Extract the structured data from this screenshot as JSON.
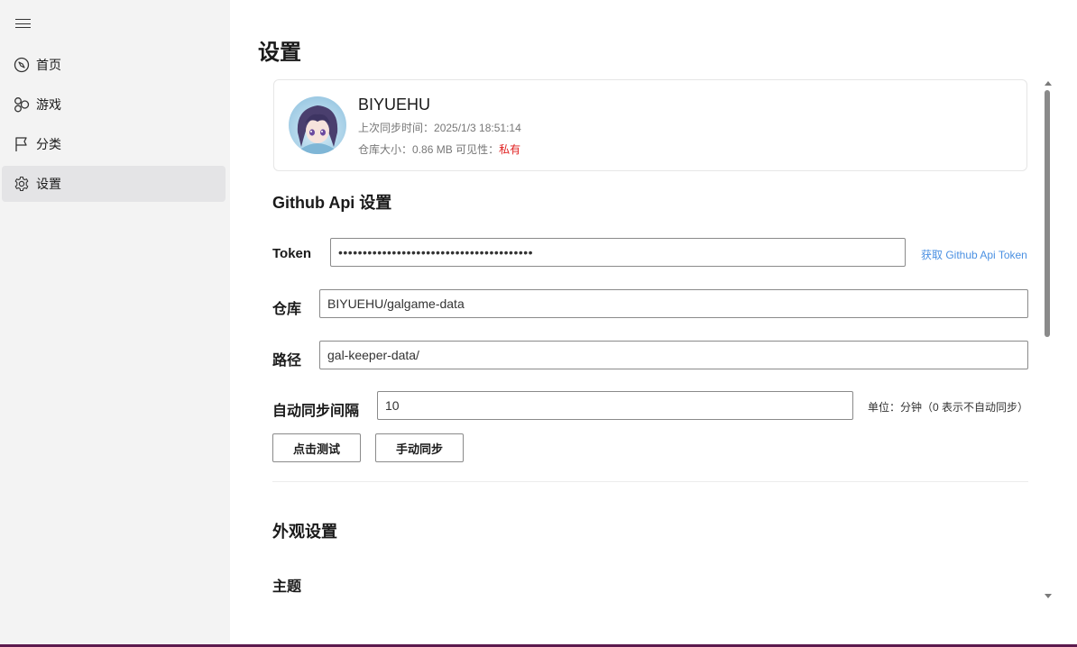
{
  "sidebar": {
    "menu_icon": "hamburger-menu-icon",
    "items": [
      {
        "label": "首页",
        "icon": "compass-icon",
        "active": false
      },
      {
        "label": "游戏",
        "icon": "shapes-icon",
        "active": false
      },
      {
        "label": "分类",
        "icon": "flag-icon",
        "active": false
      },
      {
        "label": "设置",
        "icon": "gear-icon",
        "active": true
      }
    ]
  },
  "page": {
    "title": "设置"
  },
  "profile": {
    "name": "BIYUEHU",
    "sync_label": "上次同步时间：",
    "sync_time": "2025/1/3 18:51:14",
    "size_label": "仓库大小：",
    "size_value": "0.86 MB",
    "visibility_label": "可见性：",
    "visibility_value": "私有"
  },
  "github": {
    "section_title": "Github Api 设置",
    "token_label": "Token",
    "token_value": "••••••••••••••••••••••••••••••••••••••••",
    "token_link": "获取 Github Api Token",
    "repo_label": "仓库",
    "repo_value": "BIYUEHU/galgame-data",
    "path_label": "路径",
    "path_value": "gal-keeper-data/",
    "interval_label": "自动同步间隔",
    "interval_value": "10",
    "interval_hint": "单位：分钟（0 表示不自动同步）",
    "test_button": "点击测试",
    "sync_button": "手动同步"
  },
  "appearance": {
    "section_title": "外观设置",
    "theme_label": "主题"
  },
  "colors": {
    "sidebar_bg": "#f3f3f3",
    "active_item_bg": "#e4e4e6",
    "link": "#4a90e2",
    "private": "#e02020"
  }
}
